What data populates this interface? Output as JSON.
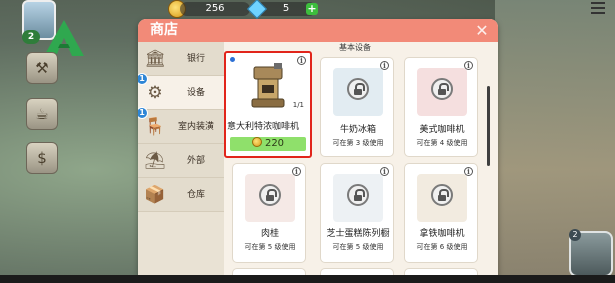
{
  "hud": {
    "coins": "256",
    "gems": "5",
    "level": "2",
    "minimap_badge": "2"
  },
  "shop": {
    "title": "商店",
    "close_icon": "close-icon",
    "tabs": [
      {
        "label": "银行",
        "icon": "bank-icon",
        "badge": ""
      },
      {
        "label": "设备",
        "icon": "mixer-icon",
        "badge": "1",
        "active": true
      },
      {
        "label": "室内装潢",
        "icon": "chair-icon",
        "badge": "1"
      },
      {
        "label": "外部",
        "icon": "bench-icon",
        "badge": ""
      },
      {
        "label": "仓库",
        "icon": "boxes-icon",
        "badge": ""
      }
    ],
    "section_title": "基本设备",
    "items": [
      {
        "name": "意大利特浓咖啡机",
        "count": "1/1",
        "price": "220",
        "locked": false
      },
      {
        "name": "牛奶冰箱",
        "unlock": "可在第 3 级使用",
        "locked": true
      },
      {
        "name": "美式咖啡机",
        "unlock": "可在第 4 级使用",
        "locked": true
      },
      {
        "name": "肉桂",
        "unlock": "可在第 5 级使用",
        "locked": true
      },
      {
        "name": "芝士蛋糕陈列橱",
        "unlock": "可在第 5 级使用",
        "locked": true
      },
      {
        "name": "拿铁咖啡机",
        "unlock": "可在第 6 级使用",
        "locked": true
      }
    ]
  },
  "colors": {
    "header": "#f28a78",
    "price_bar": "#8fe06b",
    "highlight": "#e1251b",
    "badge": "#2e86d6"
  }
}
